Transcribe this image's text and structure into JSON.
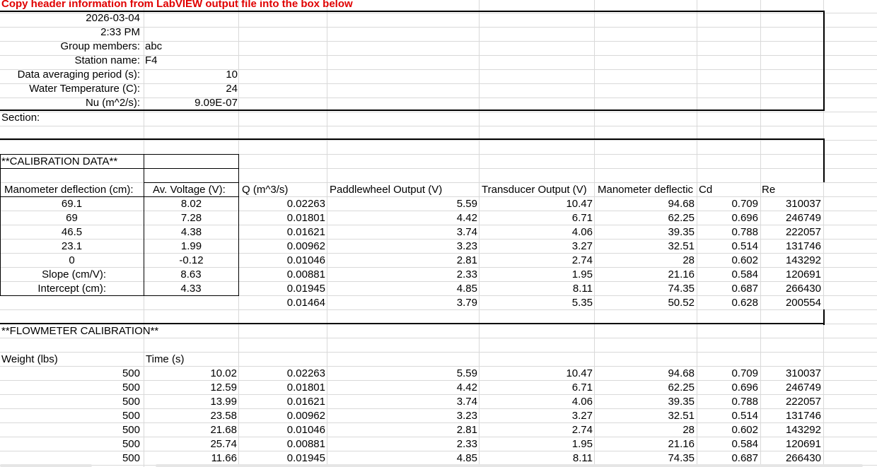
{
  "banner": "Copy header information from LabVIEW output file into the box below",
  "header": {
    "date": "2026-03-04",
    "time": "2:33 PM",
    "group_label": "Group members:",
    "group_value": "abc",
    "station_label": "Station name:",
    "station_value": "F4",
    "avg_label": "Data averaging period (s):",
    "avg_value": "10",
    "temp_label": "Water Temperature (C):",
    "temp_value": "24",
    "nu_label": "Nu (m^2/s):",
    "nu_value": "9.09E-07"
  },
  "section_label": "Section:",
  "calibration": {
    "title": "**CALIBRATION DATA**",
    "col1": "Manometer deflection (cm):",
    "col2": "Av. Voltage (V):",
    "rows": [
      [
        "69.1",
        "8.02"
      ],
      [
        "69",
        "7.28"
      ],
      [
        "46.5",
        "4.38"
      ],
      [
        "23.1",
        "1.99"
      ],
      [
        "0",
        "-0.12"
      ]
    ],
    "slope_label": "Slope (cm/V):",
    "slope_value": "8.63",
    "intercept_label": "Intercept (cm):",
    "intercept_value": "4.33"
  },
  "results_headers": {
    "q": "Q (m^3/s)",
    "paddle": "Paddlewheel Output (V)",
    "transducer": "Transducer Output (V)",
    "manometer": "Manometer deflectic",
    "cd": "Cd",
    "re": "Re"
  },
  "results_upper": [
    [
      "0.02263",
      "5.59",
      "10.47",
      "94.68",
      "0.709",
      "310037"
    ],
    [
      "0.01801",
      "4.42",
      "6.71",
      "62.25",
      "0.696",
      "246749"
    ],
    [
      "0.01621",
      "3.74",
      "4.06",
      "39.35",
      "0.788",
      "222057"
    ],
    [
      "0.00962",
      "3.23",
      "3.27",
      "32.51",
      "0.514",
      "131746"
    ],
    [
      "0.01046",
      "2.81",
      "2.74",
      "28",
      "0.602",
      "143292"
    ],
    [
      "0.00881",
      "2.33",
      "1.95",
      "21.16",
      "0.584",
      "120691"
    ],
    [
      "0.01945",
      "4.85",
      "8.11",
      "74.35",
      "0.687",
      "266430"
    ],
    [
      "0.01464",
      "3.79",
      "5.35",
      "50.52",
      "0.628",
      "200554"
    ]
  ],
  "flowmeter": {
    "title": "**FLOWMETER CALIBRATION**",
    "weight_label": "Weight (lbs)",
    "time_label": "Time (s)",
    "rows": [
      [
        "500",
        "10.02",
        "0.02263",
        "5.59",
        "10.47",
        "94.68",
        "0.709",
        "310037"
      ],
      [
        "500",
        "12.59",
        "0.01801",
        "4.42",
        "6.71",
        "62.25",
        "0.696",
        "246749"
      ],
      [
        "500",
        "13.99",
        "0.01621",
        "3.74",
        "4.06",
        "39.35",
        "0.788",
        "222057"
      ],
      [
        "500",
        "23.58",
        "0.00962",
        "3.23",
        "3.27",
        "32.51",
        "0.514",
        "131746"
      ],
      [
        "500",
        "21.68",
        "0.01046",
        "2.81",
        "2.74",
        "28",
        "0.602",
        "143292"
      ],
      [
        "500",
        "25.74",
        "0.00881",
        "2.33",
        "1.95",
        "21.16",
        "0.584",
        "120691"
      ],
      [
        "500",
        "11.66",
        "0.01945",
        "4.85",
        "8.11",
        "74.35",
        "0.687",
        "266430"
      ]
    ]
  }
}
